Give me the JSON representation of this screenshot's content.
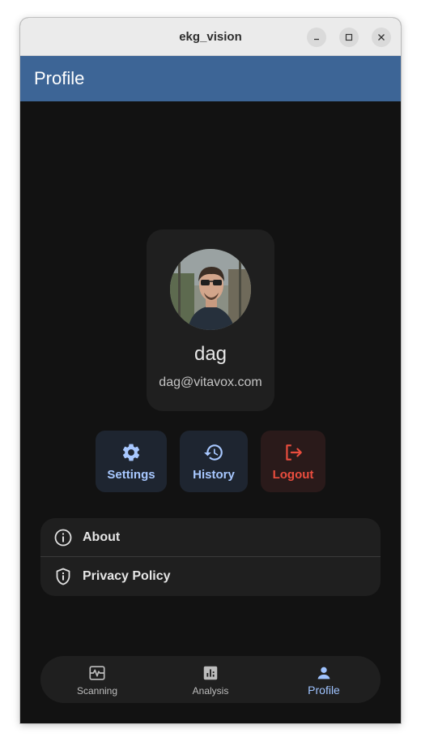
{
  "window": {
    "title": "ekg_vision"
  },
  "appbar": {
    "title": "Profile"
  },
  "profile": {
    "name": "dag",
    "email": "dag@vitavox.com"
  },
  "actions": [
    {
      "label": "Settings",
      "icon": "gear-icon",
      "color": "#a8c8ff"
    },
    {
      "label": "History",
      "icon": "history-icon",
      "color": "#a8c8ff"
    },
    {
      "label": "Logout",
      "icon": "logout-icon",
      "color": "#ea4d3e"
    }
  ],
  "menu": [
    {
      "label": "About",
      "icon": "info-icon"
    },
    {
      "label": "Privacy Policy",
      "icon": "shield-icon"
    }
  ],
  "nav": {
    "items": [
      {
        "label": "Scanning",
        "icon": "ecg-icon"
      },
      {
        "label": "Analysis",
        "icon": "analytics-icon"
      },
      {
        "label": "Profile",
        "icon": "person-icon"
      }
    ],
    "active": "Profile"
  },
  "colors": {
    "appbar": "#3d6596",
    "background": "#121212",
    "surface": "#1f1f1f",
    "accent": "#a8c8ff",
    "danger": "#ea4d3e"
  }
}
